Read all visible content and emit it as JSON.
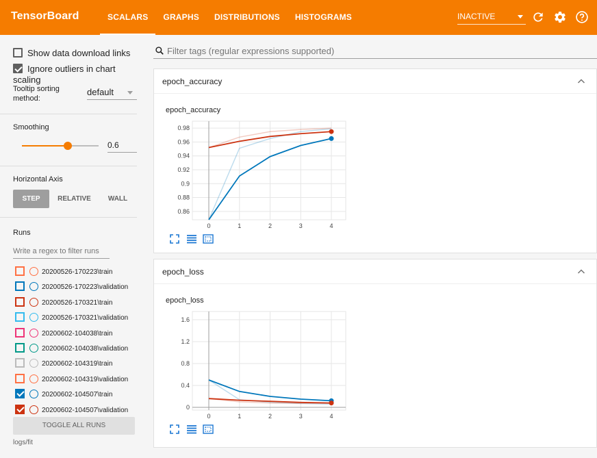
{
  "topbar": {
    "brand": "TensorBoard",
    "tabs": [
      "SCALARS",
      "GRAPHS",
      "DISTRIBUTIONS",
      "HISTOGRAMS"
    ],
    "active_tab": "SCALARS",
    "mode_select": "INACTIVE",
    "accent": "#f57c00"
  },
  "sidebar": {
    "show_download": "Show data download links",
    "ignore_outliers": "Ignore outliers in chart scaling",
    "show_download_checked": false,
    "ignore_outliers_checked": true,
    "tooltip_label_1": "Tooltip sorting",
    "tooltip_label_2": "method:",
    "tooltip_value": "default",
    "smoothing_label": "Smoothing",
    "smoothing_value": "0.6",
    "horizontal_axis_label": "Horizontal Axis",
    "axis_options": [
      "STEP",
      "RELATIVE",
      "WALL"
    ],
    "axis_selected": "STEP",
    "runs_label": "Runs",
    "runs_filter_placeholder": "Write a regex to filter runs",
    "runs": [
      {
        "name": "20200526-170223\\train",
        "color": "#ff7043",
        "checked": false
      },
      {
        "name": "20200526-170223\\validation",
        "color": "#0077bb",
        "checked": false
      },
      {
        "name": "20200526-170321\\train",
        "color": "#cc3311",
        "checked": false
      },
      {
        "name": "20200526-170321\\validation",
        "color": "#33bbee",
        "checked": false
      },
      {
        "name": "20200602-104038\\train",
        "color": "#ee3377",
        "checked": false
      },
      {
        "name": "20200602-104038\\validation",
        "color": "#009988",
        "checked": false
      },
      {
        "name": "20200602-104319\\train",
        "color": "#bbbbbb",
        "checked": false
      },
      {
        "name": "20200602-104319\\validation",
        "color": "#ff7043",
        "checked": false
      },
      {
        "name": "20200602-104507\\train",
        "color": "#0077bb",
        "checked": true
      },
      {
        "name": "20200602-104507\\validation",
        "color": "#cc3311",
        "checked": true
      }
    ],
    "toggle_all": "TOGGLE ALL RUNS",
    "logdir": "logs/fit"
  },
  "main": {
    "search_placeholder": "Filter tags (regular expressions supported)",
    "cards": [
      {
        "title": "epoch_accuracy",
        "chart_title": "epoch_accuracy"
      },
      {
        "title": "epoch_loss",
        "chart_title": "epoch_loss"
      }
    ]
  },
  "chart_data": [
    {
      "type": "line",
      "title": "epoch_accuracy",
      "x": [
        0,
        1,
        2,
        3,
        4
      ],
      "xticks": [
        "0",
        "1",
        "2",
        "3",
        "4"
      ],
      "yticks": [
        "0.86",
        "0.88",
        "0.9",
        "0.92",
        "0.94",
        "0.96",
        "0.98"
      ],
      "ylim": [
        0.848,
        0.99
      ],
      "series": [
        {
          "color": "#0077bb",
          "smoothed": [
            0.848,
            0.911,
            0.939,
            0.955,
            0.965
          ],
          "raw": [
            0.848,
            0.951,
            0.965,
            0.975,
            0.979
          ]
        },
        {
          "color": "#cc3311",
          "smoothed": [
            0.952,
            0.961,
            0.968,
            0.972,
            0.975
          ],
          "raw": [
            0.952,
            0.967,
            0.975,
            0.978,
            0.98
          ]
        }
      ]
    },
    {
      "type": "line",
      "title": "epoch_loss",
      "x": [
        0,
        1,
        2,
        3,
        4
      ],
      "xticks": [
        "0",
        "1",
        "2",
        "3",
        "4"
      ],
      "yticks": [
        "0",
        "0.4",
        "0.8",
        "1.2",
        "1.6"
      ],
      "ylim": [
        -0.05,
        1.75
      ],
      "series": [
        {
          "color": "#0077bb",
          "smoothed": [
            0.5,
            0.29,
            0.2,
            0.15,
            0.12
          ],
          "raw": [
            0.5,
            0.14,
            0.09,
            0.07,
            0.06
          ]
        },
        {
          "color": "#cc3311",
          "smoothed": [
            0.16,
            0.13,
            0.11,
            0.09,
            0.08
          ],
          "raw": [
            0.16,
            0.1,
            0.08,
            0.07,
            0.07
          ]
        }
      ]
    }
  ]
}
